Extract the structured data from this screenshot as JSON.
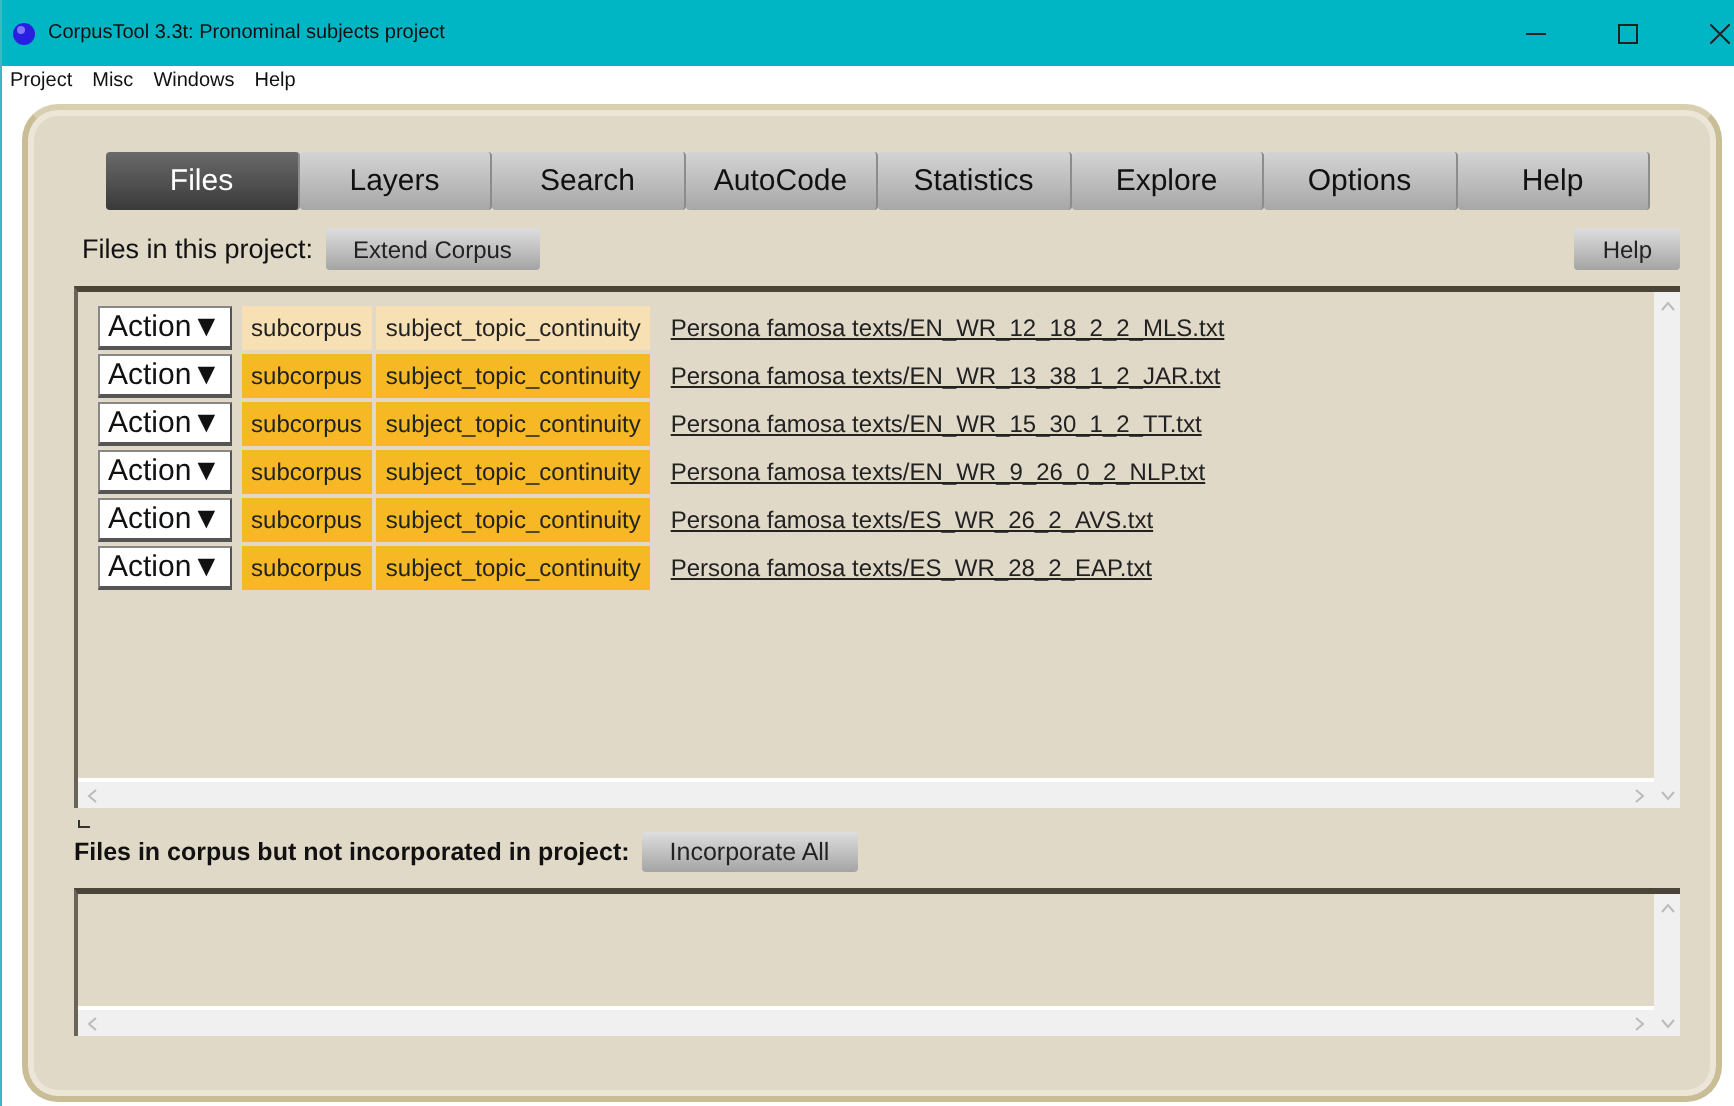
{
  "window": {
    "title": "CorpusTool 3.3t: Pronominal subjects project"
  },
  "menu": [
    "Project",
    "Misc",
    "Windows",
    "Help"
  ],
  "tabs": [
    {
      "label": "Files",
      "selected": true
    },
    {
      "label": "Layers",
      "selected": false
    },
    {
      "label": "Search",
      "selected": false
    },
    {
      "label": "AutoCode",
      "selected": false
    },
    {
      "label": "Statistics",
      "selected": false
    },
    {
      "label": "Explore",
      "selected": false
    },
    {
      "label": "Options",
      "selected": false
    },
    {
      "label": "Help",
      "selected": false
    }
  ],
  "project_files": {
    "label": "Files in this project:",
    "extend_button": "Extend Corpus",
    "help_button": "Help",
    "rows": [
      {
        "action": "Action▼",
        "tags": [
          "subcorpus",
          "subject_topic_continuity"
        ],
        "dimmed": true,
        "file": "Persona famosa texts/EN_WR_12_18_2_2_MLS.txt"
      },
      {
        "action": "Action▼",
        "tags": [
          "subcorpus",
          "subject_topic_continuity"
        ],
        "dimmed": false,
        "file": "Persona famosa texts/EN_WR_13_38_1_2_JAR.txt"
      },
      {
        "action": "Action▼",
        "tags": [
          "subcorpus",
          "subject_topic_continuity"
        ],
        "dimmed": false,
        "file": "Persona famosa texts/EN_WR_15_30_1_2_TT.txt"
      },
      {
        "action": "Action▼",
        "tags": [
          "subcorpus",
          "subject_topic_continuity"
        ],
        "dimmed": false,
        "file": "Persona famosa texts/EN_WR_9_26_0_2_NLP.txt"
      },
      {
        "action": "Action▼",
        "tags": [
          "subcorpus",
          "subject_topic_continuity"
        ],
        "dimmed": false,
        "file": "Persona famosa texts/ES_WR_26_2_AVS.txt"
      },
      {
        "action": "Action▼",
        "tags": [
          "subcorpus",
          "subject_topic_continuity"
        ],
        "dimmed": false,
        "file": "Persona famosa texts/ES_WR_28_2_EAP.txt"
      }
    ]
  },
  "unincorporated": {
    "label": "Files in corpus but not incorporated in project:",
    "button": "Incorporate All"
  }
}
